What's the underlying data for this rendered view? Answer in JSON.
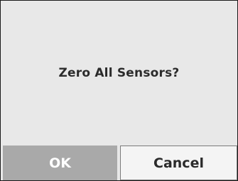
{
  "dialog": {
    "message": "Zero All Sensors?",
    "buttons": {
      "ok_label": "OK",
      "cancel_label": "Cancel"
    }
  },
  "colors": {
    "background": "#e8e8e8",
    "ok_button_bg": "#a9a9a9",
    "ok_button_text": "#ffffff",
    "cancel_button_bg": "#f4f4f4",
    "text": "#2b2b2b"
  }
}
